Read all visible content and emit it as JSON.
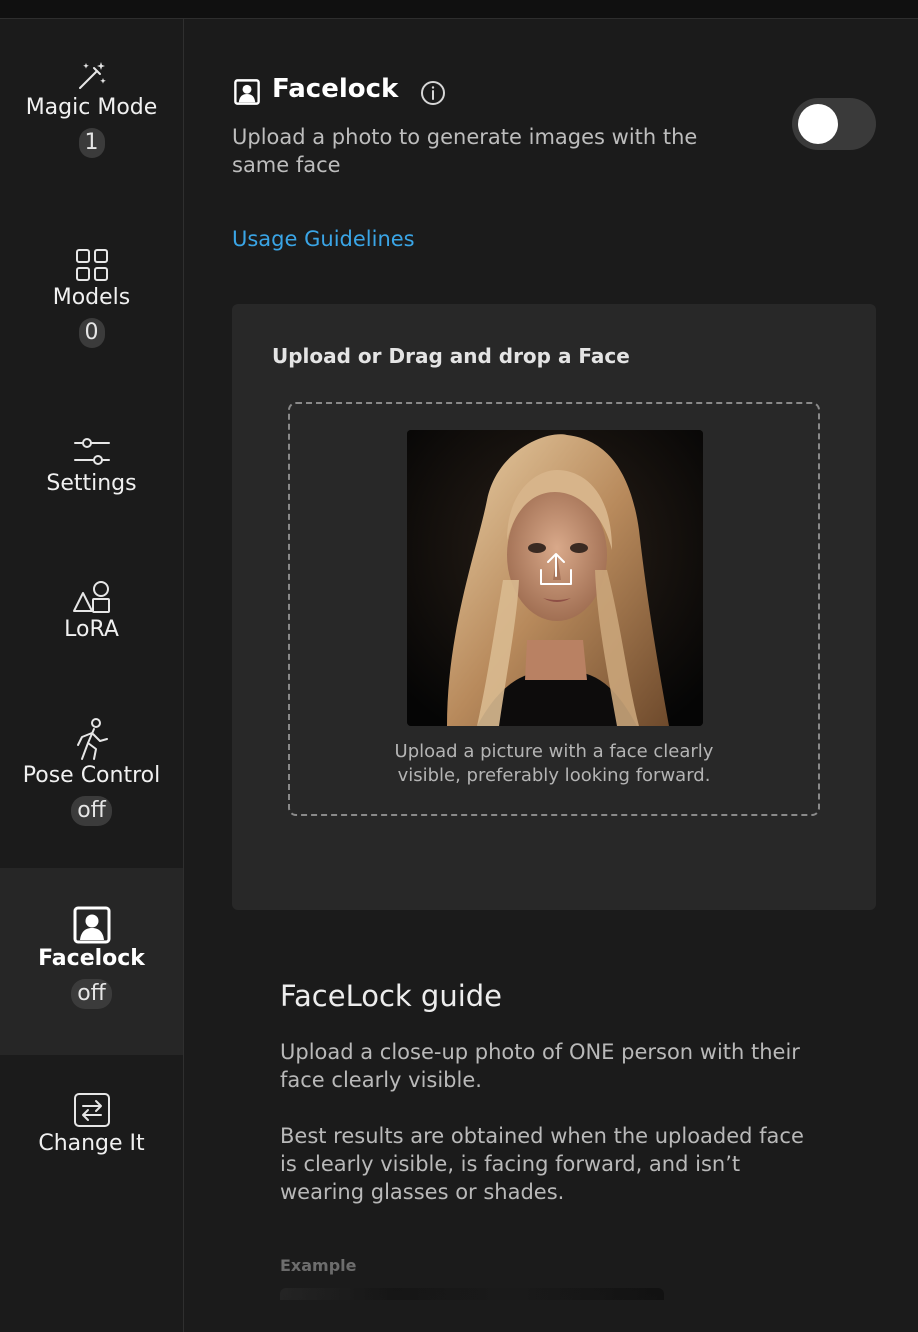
{
  "sidebar": {
    "items": [
      {
        "label": "Magic Mode",
        "icon": "magic-wand-icon",
        "badge": "1"
      },
      {
        "label": "Models",
        "icon": "grid-icon",
        "badge": "0"
      },
      {
        "label": "Settings",
        "icon": "sliders-icon"
      },
      {
        "label": "LoRA",
        "icon": "shapes-icon"
      },
      {
        "label": "Pose Control",
        "icon": "walking-person-icon",
        "badge": "off"
      },
      {
        "label": "Facelock",
        "icon": "portrait-icon",
        "badge": "off",
        "active": true
      },
      {
        "label": "Change It",
        "icon": "swap-arrows-icon"
      }
    ]
  },
  "header": {
    "title": "Facelock",
    "subtitle": "Upload a photo to generate images with the same face",
    "toggle_on": false,
    "usage_link": "Usage Guidelines"
  },
  "upload": {
    "title": "Upload or Drag and drop a Face",
    "hint_line1": "Upload a picture with a face clearly",
    "hint_line2": "visible, preferably looking forward."
  },
  "guide": {
    "title": "FaceLock guide",
    "paragraph1": "Upload a close-up photo of ONE person with their face clearly visible.",
    "paragraph2": "Best results are obtained when the uploaded face is clearly visible, is facing forward, and isn’t wearing glasses or shades.",
    "example_label": "Example"
  },
  "colors": {
    "accent_link": "#3aa5e6",
    "background": "#1b1b1b",
    "card": "#282828",
    "active_item": "#262626"
  }
}
